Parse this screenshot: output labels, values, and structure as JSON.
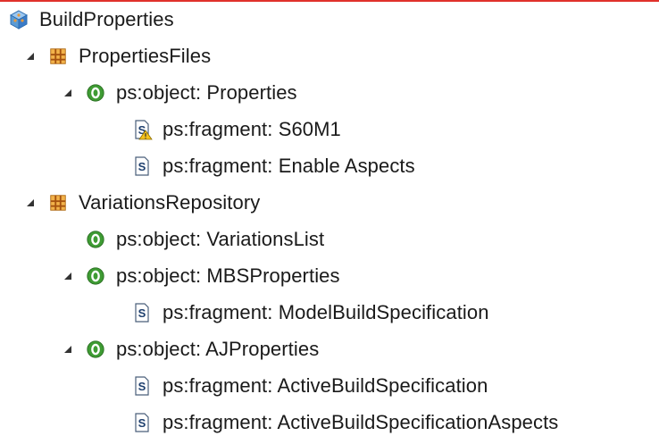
{
  "tree": {
    "root": {
      "label": "BuildProperties",
      "icon": "package-icon"
    },
    "files": {
      "label": "PropertiesFiles",
      "icon": "grid-folder-icon",
      "object": {
        "label": "ps:object: Properties",
        "fragments": [
          {
            "label": "ps:fragment: S60M1",
            "icon": "fragment-warning-icon"
          },
          {
            "label": "ps:fragment: Enable Aspects",
            "icon": "fragment-icon"
          }
        ]
      }
    },
    "repo": {
      "label": "VariationsRepository",
      "icon": "grid-folder-icon",
      "objects": [
        {
          "label": "ps:object: VariationsList",
          "fragments": []
        },
        {
          "label": "ps:object: MBSProperties",
          "fragments": [
            {
              "label": "ps:fragment: ModelBuildSpecification"
            }
          ]
        },
        {
          "label": "ps:object: AJProperties",
          "fragments": [
            {
              "label": "ps:fragment: ActiveBuildSpecification"
            },
            {
              "label": "ps:fragment: ActiveBuildSpecificationAspects"
            }
          ]
        }
      ]
    }
  },
  "colors": {
    "accent_line": "#e0312b",
    "object_green": "#3e9b33",
    "folder_orange": "#d98b2b"
  }
}
